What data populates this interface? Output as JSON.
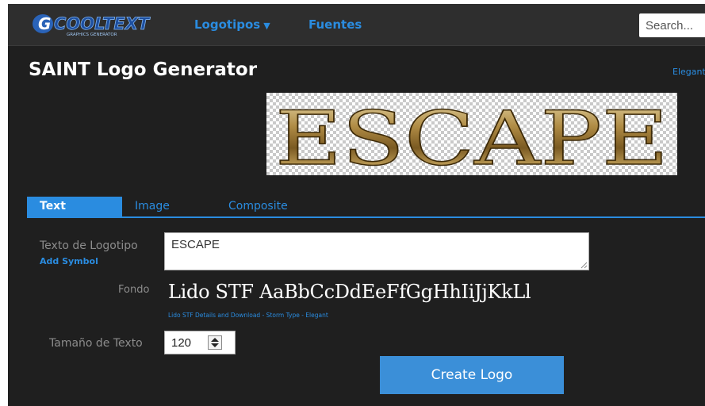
{
  "nav": {
    "logo_text": "COOLTEXT",
    "logo_subtitle": "GRAPHICS GENERATOR",
    "items": [
      {
        "label": "Logotipos",
        "icon": "caret-down-icon"
      },
      {
        "label": "Fuentes"
      }
    ],
    "search_placeholder": "Search..."
  },
  "page": {
    "title": "SAINT Logo Generator",
    "side_link": "Elegant"
  },
  "preview": {
    "text": "ESCAPE"
  },
  "tabs": [
    {
      "label": "Text",
      "active": true
    },
    {
      "label": "Image",
      "active": false
    },
    {
      "label": "Composite",
      "active": false
    }
  ],
  "form": {
    "logo_text_label": "Texto de Logotipo",
    "add_symbol": "Add Symbol",
    "logo_text_value": "ESCAPE",
    "font_label": "Fondo",
    "font_sample": "Lido STF AaBbCcDdEeFfGgHhIiJjKkLl",
    "font_link": "Lido STF Details and Download - Storm Type - Elegant",
    "size_label": "Tamaño de Texto",
    "size_value": "120",
    "create_button": "Create Logo"
  },
  "colors": {
    "accent": "#2a8ce0",
    "background": "#1f1f1f",
    "topbar": "#2e2e2e",
    "button": "#3b8fd8"
  }
}
